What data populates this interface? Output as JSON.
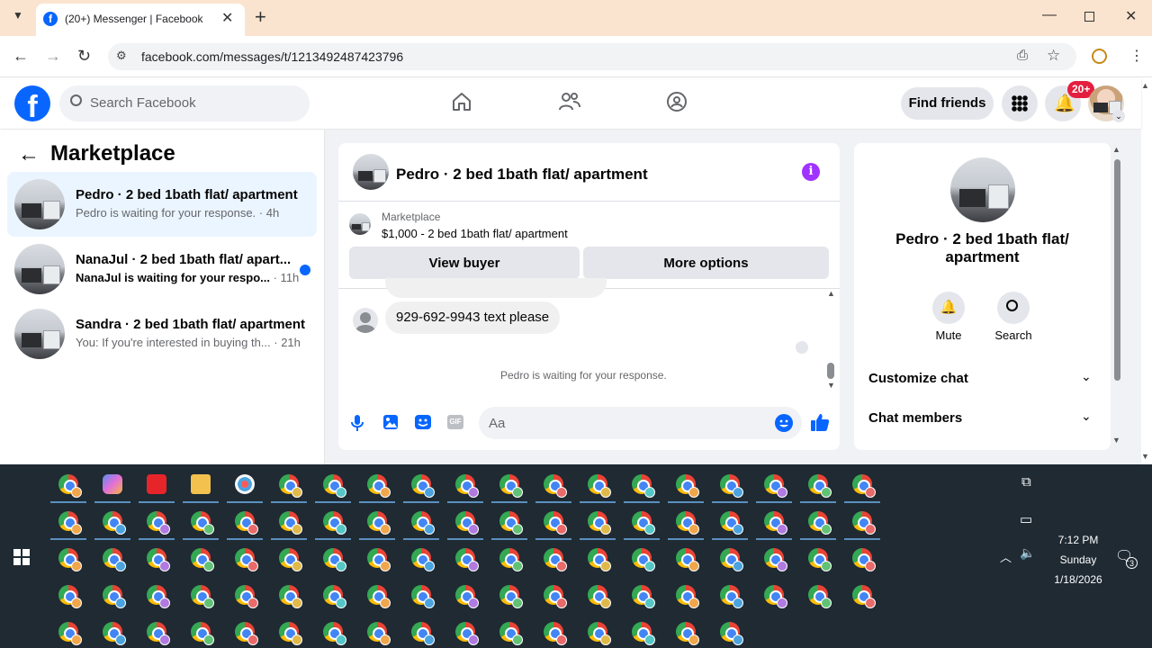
{
  "browser": {
    "tab_title": "(20+) Messenger | Facebook",
    "url": "facebook.com/messages/t/1213492487423796"
  },
  "header": {
    "search_placeholder": "Search Facebook",
    "find_friends": "Find friends",
    "notifications_badge": "20+"
  },
  "left": {
    "title": "Marketplace",
    "conversations": [
      {
        "title": "Pedro · 2 bed 1bath flat/ apartment",
        "preview": "Pedro is waiting for your response.",
        "time": " · 4h",
        "selected": true,
        "unread": false
      },
      {
        "title": "NanaJul · 2 bed 1bath flat/ apart...",
        "preview": "NanaJul is waiting for your respo...",
        "time": " · 11h",
        "selected": false,
        "unread": true
      },
      {
        "title": "Sandra · 2 bed 1bath flat/ apartment",
        "preview": "You: If you're interested in buying th...",
        "time": " · 21h",
        "selected": false,
        "unread": false
      }
    ]
  },
  "chat": {
    "title": "Pedro · 2 bed 1bath flat/ apartment",
    "listing_source": "Marketplace",
    "listing_line": "$1,000 - 2 bed 1bath flat/ apartment",
    "view_buyer": "View buyer",
    "more_options": "More options",
    "message": "929-692-9943 text please",
    "status": "Pedro is waiting for your response.",
    "composer_placeholder": "Aa"
  },
  "info": {
    "name": "Pedro · 2 bed 1bath flat/ apartment",
    "mute": "Mute",
    "search": "Search",
    "customize": "Customize chat",
    "members": "Chat members"
  },
  "taskbar": {
    "time": "7:12 PM",
    "day": "Sunday",
    "date": "1/18/2026",
    "notification_count": "3"
  },
  "colors": {
    "fb_blue": "#0866ff",
    "messenger_purple": "#a033ff",
    "notif_red": "#e41e3f"
  }
}
